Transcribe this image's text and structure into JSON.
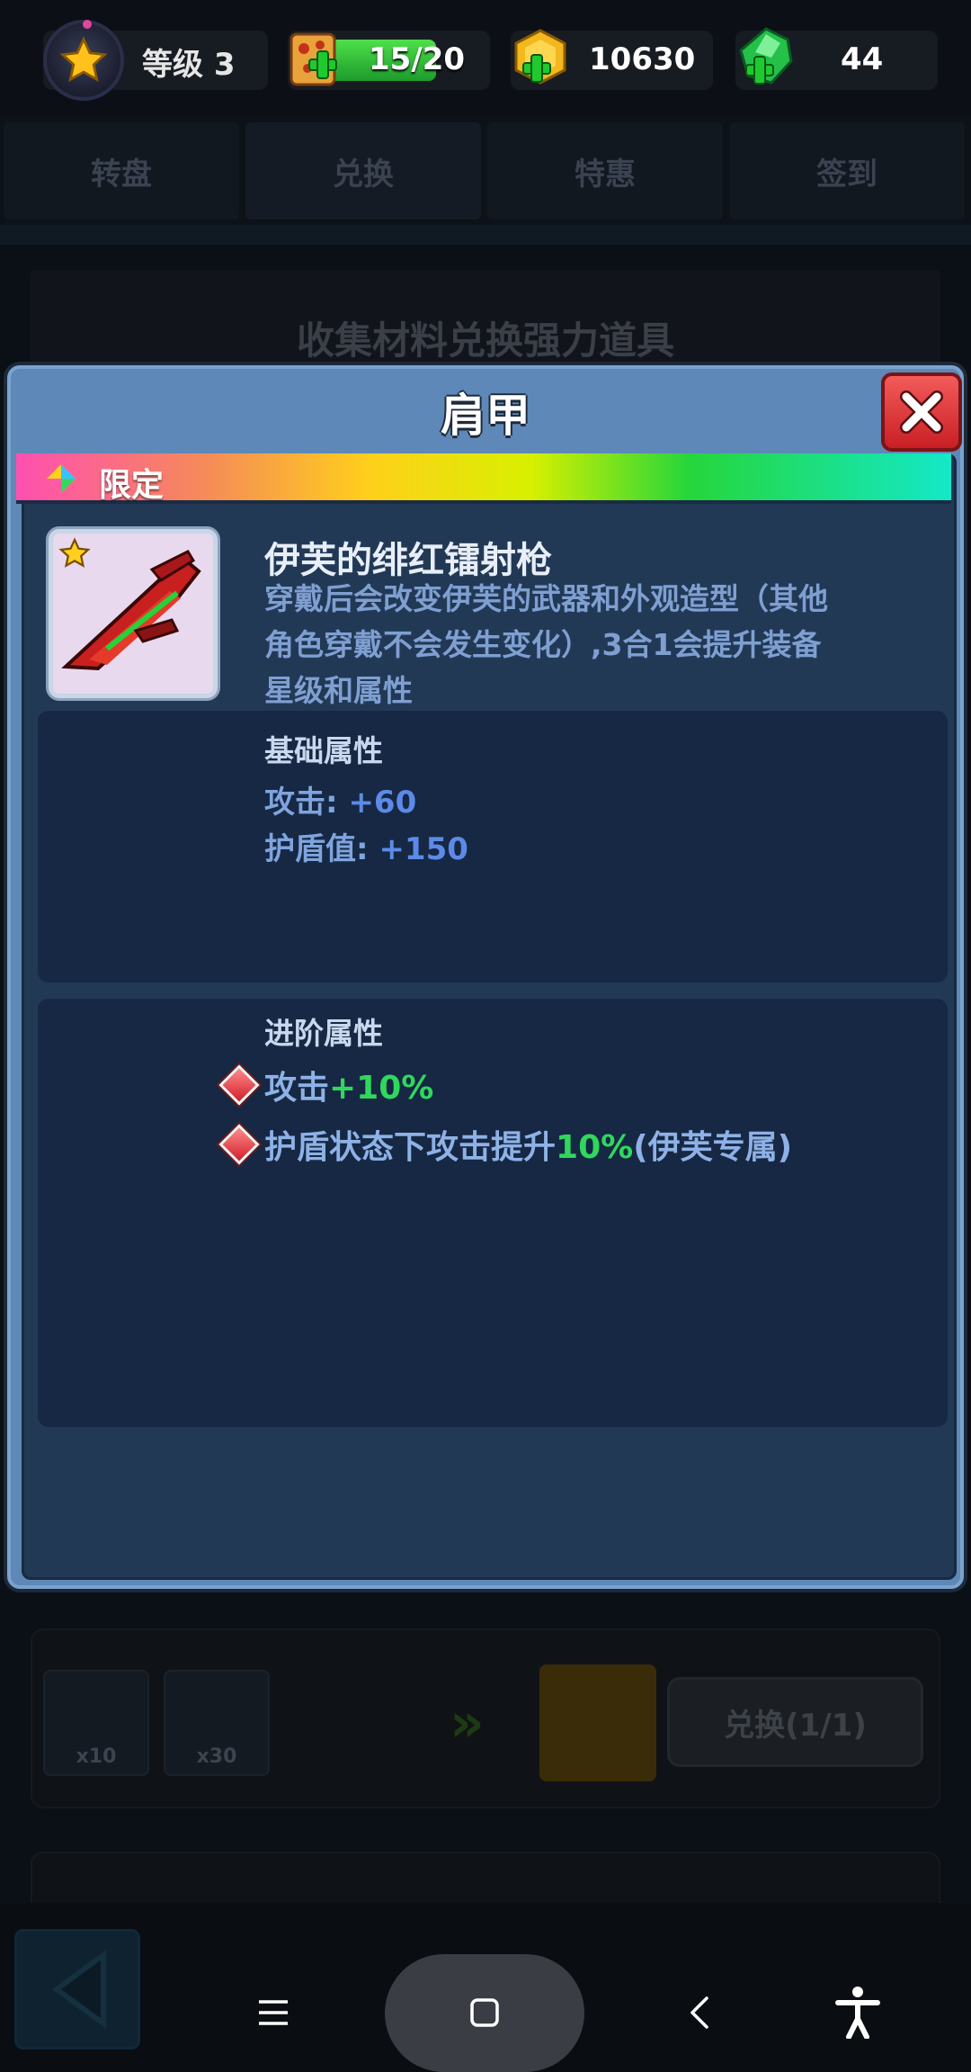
{
  "topbar": {
    "level_label": "等级 3",
    "energy_value": "15/20",
    "coins": "10630",
    "gems": "44",
    "colors": {
      "energy_fill": "#2fb83a",
      "accent_pink": "#e0469e"
    },
    "icons": [
      "level-star-icon",
      "energy-pizza-icon",
      "coin-icon",
      "gem-icon"
    ]
  },
  "tabs": [
    {
      "label": "转盘"
    },
    {
      "label": "兑换"
    },
    {
      "label": "特惠"
    },
    {
      "label": "签到"
    }
  ],
  "background_page": {
    "banner_text": "收集材料兑换强力道具",
    "materials": [
      {
        "qty": "x10"
      },
      {
        "qty": "x30"
      }
    ],
    "exchange_button": "兑换(1/1)"
  },
  "modal": {
    "title": "肩甲",
    "rarity": "限定",
    "item": {
      "name": "伊芙的绯红镭射枪",
      "description_lines": [
        "穿戴后会改变伊芙的武器和外观造型（其他",
        "角色穿戴不会发生变化）,3合1会提升装备",
        "星级和属性"
      ]
    },
    "basic": {
      "title": "基础属性",
      "stats": [
        {
          "label": "攻击: ",
          "value": "+60"
        },
        {
          "label": "护盾值: ",
          "value": "+150"
        }
      ]
    },
    "advanced": {
      "title": "进阶属性",
      "lines": [
        {
          "pre": "攻击",
          "highlight": "+10%",
          "post": ""
        },
        {
          "pre": "护盾状态下攻击提升",
          "highlight": "10%",
          "post": "(伊芙专属)"
        }
      ]
    },
    "colors": {
      "close_red": "#d8262b",
      "stat_blue": "#5d8ae8",
      "highlight_green": "#2fd85c"
    }
  },
  "system_nav": {
    "icons": [
      "back-game-icon",
      "recent-apps-icon",
      "home-icon",
      "back-icon",
      "accessibility-icon"
    ]
  }
}
